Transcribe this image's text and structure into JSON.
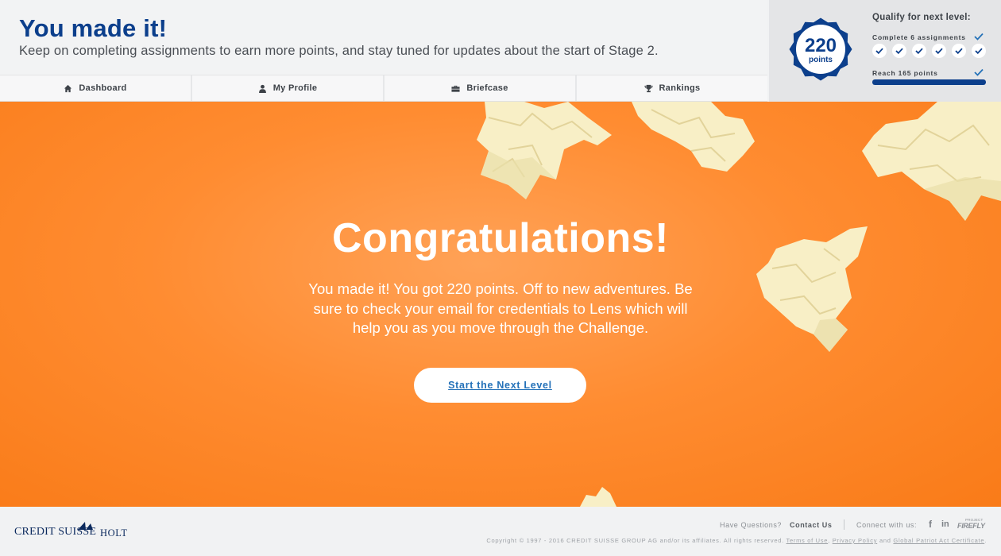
{
  "header": {
    "title": "You made it!",
    "subtitle": "Keep on completing assignments to earn more points, and stay tuned for updates about the start of Stage 2."
  },
  "nav": {
    "items": [
      {
        "label": "Dashboard",
        "icon": "home-icon"
      },
      {
        "label": "My Profile",
        "icon": "user-icon"
      },
      {
        "label": "Briefcase",
        "icon": "briefcase-icon"
      },
      {
        "label": "Rankings",
        "icon": "trophy-icon"
      }
    ]
  },
  "points_panel": {
    "points": "220",
    "points_unit": "points",
    "qualify_title": "Qualify for next level:",
    "assignments_label": "Complete 6 assignments",
    "assignments_done": 6,
    "assignments_total": 6,
    "assignments_complete": true,
    "points_label": "Reach 165 points",
    "points_progress": 1.0,
    "points_complete": true
  },
  "hero": {
    "heading": "Congratulations!",
    "message": "You made it! You got 220 points. Off to new adventures. Be sure to check your email for credentials to Lens which will help you as you move through the Challenge.",
    "cta_label": "Start the Next Level"
  },
  "footer": {
    "logo_brand": "CREDIT SUISSE",
    "logo_product": "HOLT",
    "questions_label": "Have Questions?",
    "contact_label": "Contact Us",
    "connect_label": "Connect with us:",
    "facebook_label": "f",
    "linkedin_label": "in",
    "firefly_small": "PROJECT",
    "firefly_label": "FIREFLY",
    "copyright": "Copyright © 1997 - 2016 CREDIT SUISSE GROUP AG and/or its affiliates. All rights reserved.",
    "terms_label": "Terms of Use",
    "privacy_label": "Privacy Policy",
    "and_label": "and",
    "patriot_label": "Global Patriot Act Certificate",
    "period": "."
  },
  "colors": {
    "brand_blue": "#0c3f8c",
    "hero_orange": "#ff8c31",
    "link_blue": "#2471b8"
  }
}
